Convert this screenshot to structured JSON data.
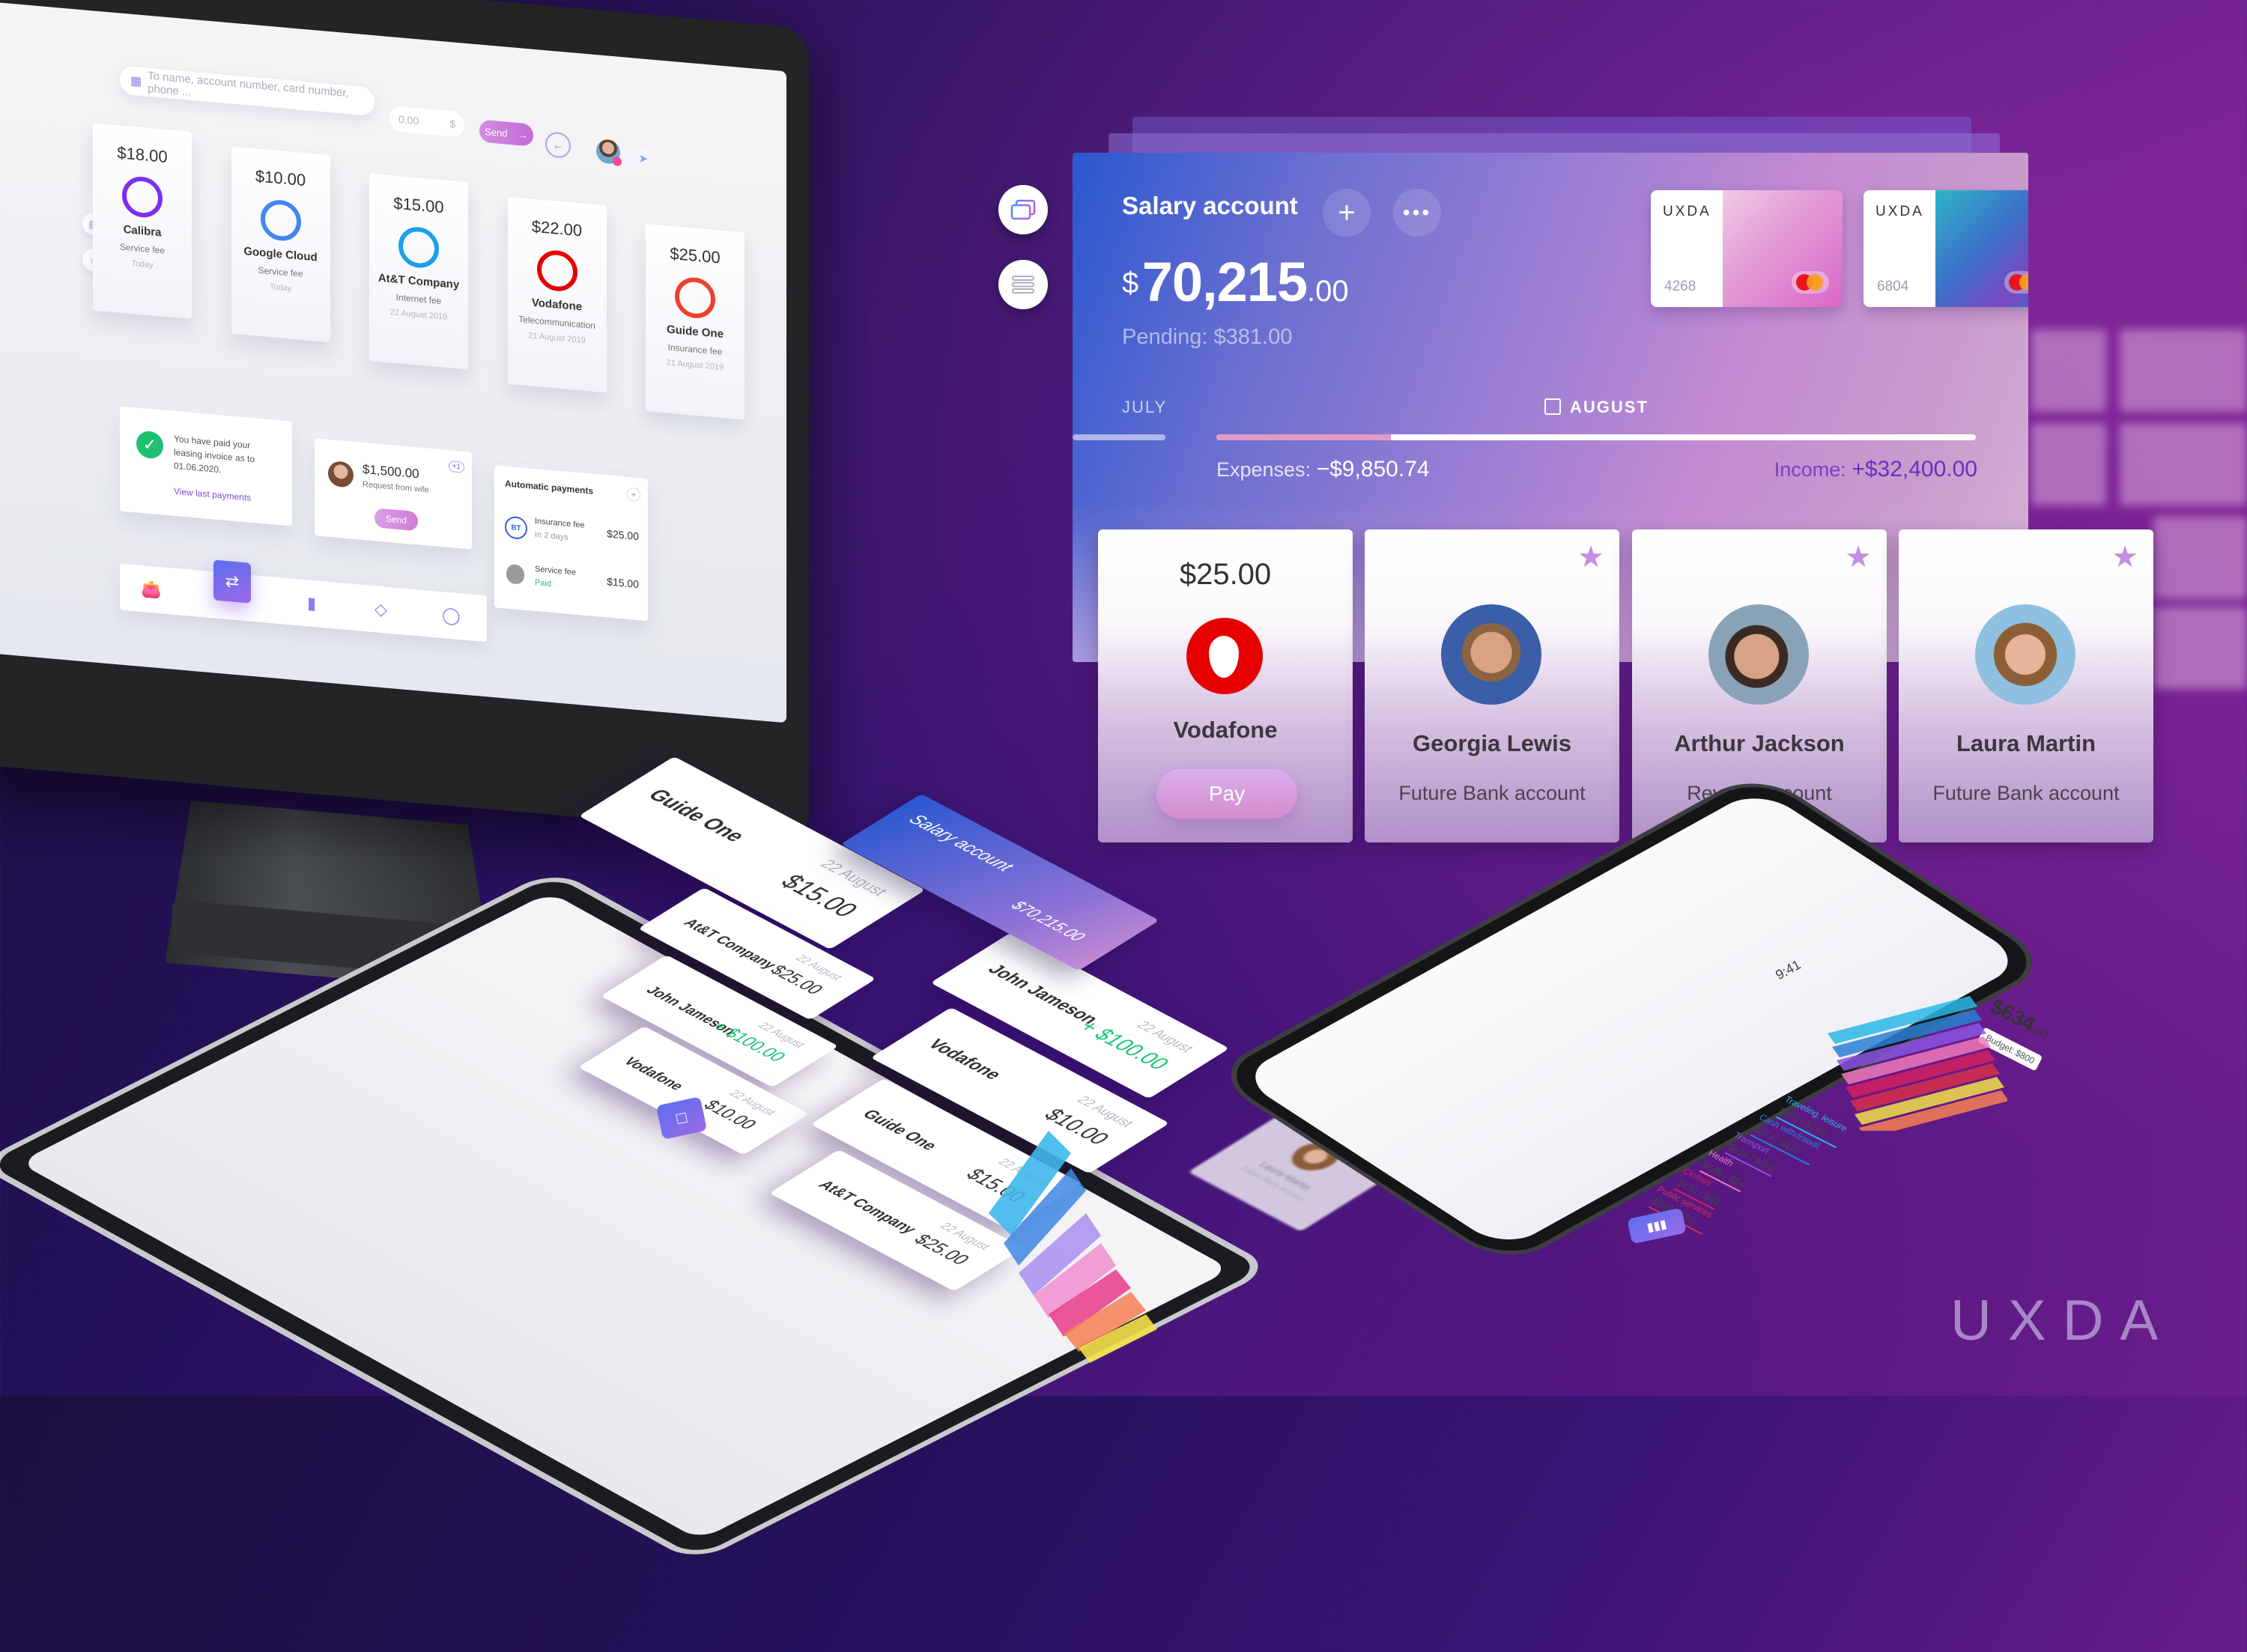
{
  "desktop": {
    "search_placeholder": "To name, account number, card number, phone ...",
    "amount_value": "0.00",
    "amount_currency": "$",
    "send_label": "Send",
    "bills": [
      {
        "amount": "$18.00",
        "name": "Calibra",
        "type": "Service fee",
        "date": "Today",
        "color": "#7b2ff0"
      },
      {
        "amount": "$10.00",
        "name": "Google Cloud",
        "type": "Service fee",
        "date": "Today",
        "color": "#4285f4"
      },
      {
        "amount": "$15.00",
        "name": "At&T Company",
        "type": "Internet fee",
        "date": "22 August 2019",
        "color": "#1aa0e8"
      },
      {
        "amount": "$22.00",
        "name": "Vodafone",
        "type": "Telecommunication",
        "date": "21 August 2019",
        "color": "#e60000"
      },
      {
        "amount": "$25.00",
        "name": "Guide One",
        "type": "Insurance fee",
        "date": "21 August 2019",
        "color": "#f0402f"
      }
    ],
    "leasing": {
      "message": "You have paid your leasing invoice as to 01.06.2020.",
      "link": "View last payments"
    },
    "request": {
      "amount": "$1,500.00",
      "label": "Request from wife",
      "button": "Send",
      "badge": "+1"
    },
    "auto_payments": {
      "title": "Automatic payments",
      "items": [
        {
          "logo": "BT",
          "name": "Insurance fee",
          "status": "In 2 days",
          "amount": "$25.00"
        },
        {
          "logo": "apple",
          "name": "Service fee",
          "status": "Paid",
          "amount": "$15.00"
        }
      ]
    },
    "nav_icons": [
      "wallet-icon",
      "transfer-icon",
      "chart-icon",
      "diamond-icon",
      "robot-icon"
    ]
  },
  "salary": {
    "title": "Salary account",
    "currency": "$",
    "balance_int": "70,215",
    "balance_dec": ".00",
    "pending": "Pending: $381.00",
    "cards": [
      {
        "brand": "UXDA",
        "last4": "4268"
      },
      {
        "brand": "UXDA",
        "last4": "6804"
      }
    ],
    "months": {
      "prev": "JULY",
      "current": "AUGUST"
    },
    "expense_fraction": 0.23,
    "expenses_label": "Expenses:",
    "expenses_value": "−$9,850.74",
    "income_label": "Income:",
    "income_value": "+$32,400.00",
    "accent": "#6630c2"
  },
  "tiles": [
    {
      "amount": "$25.00",
      "name": "Vodafone",
      "button": "Pay"
    },
    {
      "name": "Georgia Lewis",
      "account": "Future Bank account"
    },
    {
      "name": "Arthur Jackson",
      "account": "Revolut account"
    },
    {
      "name": "Laura Martin",
      "account": "Future Bank account"
    }
  ],
  "tablet": {
    "salary_title": "Salary account",
    "salary_value": "$70,215.00",
    "transactions": [
      {
        "name": "Guide One",
        "date": "22 August",
        "amount": "$15.00",
        "positive": false
      },
      {
        "name": "At&T Company",
        "date": "22 August",
        "amount": "$25.00",
        "positive": false
      },
      {
        "name": "John Jameson",
        "date": "22 August",
        "amount": "+ $100.00",
        "positive": true
      },
      {
        "name": "Vodafone",
        "date": "22 August",
        "amount": "$10.00",
        "positive": false
      },
      {
        "name": "John Jameson",
        "date": "22 August",
        "amount": "+ $100.00",
        "positive": true
      },
      {
        "name": "Vodafone",
        "date": "22 August",
        "amount": "$10.00",
        "positive": false
      },
      {
        "name": "Guide One",
        "date": "22 August",
        "amount": "$15.00",
        "positive": false
      },
      {
        "name": "At&T Company",
        "date": "22 August",
        "amount": "$25.00",
        "positive": false
      }
    ],
    "contact": {
      "name": "Laura Martin",
      "account": "Future Bank account"
    }
  },
  "phone": {
    "time": "9:41",
    "spent": "$634",
    "spent_dec": ".00",
    "budget": "Budget: $800",
    "categories": [
      {
        "name": "Traveling, leisure",
        "value": "$955 / $145",
        "color": "#2bb7e6"
      },
      {
        "name": "Cash withdrawal",
        "value": "$873 / $127",
        "color": "#2a7fd4"
      },
      {
        "name": "Transport",
        "value": "$634 / $166",
        "color": "#8a55e0"
      },
      {
        "name": "Health",
        "value": "$646 / $54",
        "color": "#ee78b8"
      },
      {
        "name": "Clothes",
        "value": "$470 / $30",
        "color": "#d4205e"
      },
      {
        "name": "Public services",
        "value": "$390 / $10",
        "color": "#d8304a"
      }
    ]
  },
  "brand": {
    "logo_text": "UXDA"
  }
}
